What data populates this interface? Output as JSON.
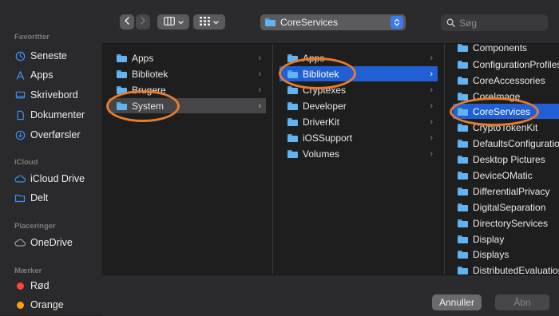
{
  "sidebar": {
    "sections": {
      "favorites": "Favoritter",
      "icloud": "iCloud",
      "locations": "Placeringer",
      "tags": "Mærker"
    },
    "favorites": [
      {
        "label": "Seneste",
        "icon": "clock-icon"
      },
      {
        "label": "Apps",
        "icon": "apps-icon"
      },
      {
        "label": "Skrivebord",
        "icon": "desktop-icon"
      },
      {
        "label": "Dokumenter",
        "icon": "document-icon"
      },
      {
        "label": "Overførsler",
        "icon": "download-icon"
      }
    ],
    "icloud": [
      {
        "label": "iCloud Drive",
        "icon": "cloud-icon"
      },
      {
        "label": "Delt",
        "icon": "shared-folder-icon"
      }
    ],
    "locations": [
      {
        "label": "OneDrive",
        "icon": "cloud-icon"
      }
    ],
    "tags": [
      {
        "label": "Rød",
        "color": "#ff453a"
      },
      {
        "label": "Orange",
        "color": "#ff9f0a"
      }
    ]
  },
  "toolbar": {
    "back_icon": "chevron-left-icon",
    "forward_icon": "chevron-right-icon",
    "view_icon": "column-view-icon",
    "group_icon": "grid-icon",
    "path": "CoreServices",
    "search_placeholder": "Søg"
  },
  "columns": [
    {
      "items": [
        {
          "label": "Apps",
          "state": ""
        },
        {
          "label": "Bibliotek",
          "state": ""
        },
        {
          "label": "Brugere",
          "state": ""
        },
        {
          "label": "System",
          "state": "gray"
        }
      ]
    },
    {
      "items": [
        {
          "label": "Apps",
          "state": ""
        },
        {
          "label": "Bibliotek",
          "state": "sel"
        },
        {
          "label": "Cryptexes",
          "state": ""
        },
        {
          "label": "Developer",
          "state": ""
        },
        {
          "label": "DriverKit",
          "state": ""
        },
        {
          "label": "iOSSupport",
          "state": ""
        },
        {
          "label": "Volumes",
          "state": ""
        }
      ]
    },
    {
      "items": [
        {
          "label": "Components",
          "state": ""
        },
        {
          "label": "ConfigurationProfiles",
          "state": ""
        },
        {
          "label": "CoreAccessories",
          "state": ""
        },
        {
          "label": "CoreImage",
          "state": ""
        },
        {
          "label": "CoreServices",
          "state": "sel"
        },
        {
          "label": "CryptoTokenKit",
          "state": ""
        },
        {
          "label": "DefaultsConfiguration",
          "state": ""
        },
        {
          "label": "Desktop Pictures",
          "state": ""
        },
        {
          "label": "DeviceOMatic",
          "state": ""
        },
        {
          "label": "DifferentialPrivacy",
          "state": ""
        },
        {
          "label": "DigitalSeparation",
          "state": ""
        },
        {
          "label": "DirectoryServices",
          "state": ""
        },
        {
          "label": "Display",
          "state": ""
        },
        {
          "label": "Displays",
          "state": ""
        },
        {
          "label": "DistributedEvaluation",
          "state": ""
        }
      ]
    }
  ],
  "buttons": {
    "cancel": "Annuller",
    "open": "Åbn"
  }
}
